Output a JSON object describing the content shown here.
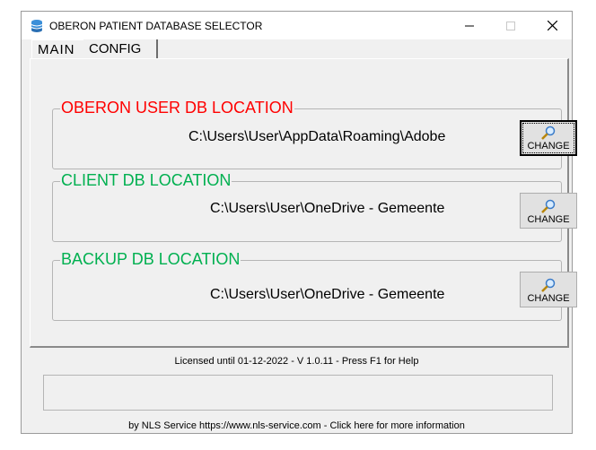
{
  "window": {
    "title": "OBERON PATIENT DATABASE SELECTOR"
  },
  "tabs": [
    {
      "label": "MAIN",
      "active": true
    },
    {
      "label": "CONFIG",
      "active": false
    }
  ],
  "groups": {
    "user_db": {
      "legend": "OBERON USER DB LOCATION",
      "legend_color": "#ff0000",
      "path": "C:\\Users\\User\\AppData\\Roaming\\Adobe",
      "button_label": "CHANGE"
    },
    "client_db": {
      "legend": "CLIENT DB LOCATION",
      "legend_color": "#00b050",
      "path": "C:\\Users\\User\\OneDrive - Gemeente",
      "button_label": "CHANGE"
    },
    "backup_db": {
      "legend": "BACKUP DB LOCATION",
      "legend_color": "#00b050",
      "path": "C:\\Users\\User\\OneDrive - Gemeente",
      "button_label": "CHANGE"
    }
  },
  "status": {
    "license_text": "Licensed until 01-12-2022 - V 1.0.11 - Press F1 for Help"
  },
  "footer": {
    "text": "by NLS Service https://www.nls-service.com - Click here for more information"
  }
}
